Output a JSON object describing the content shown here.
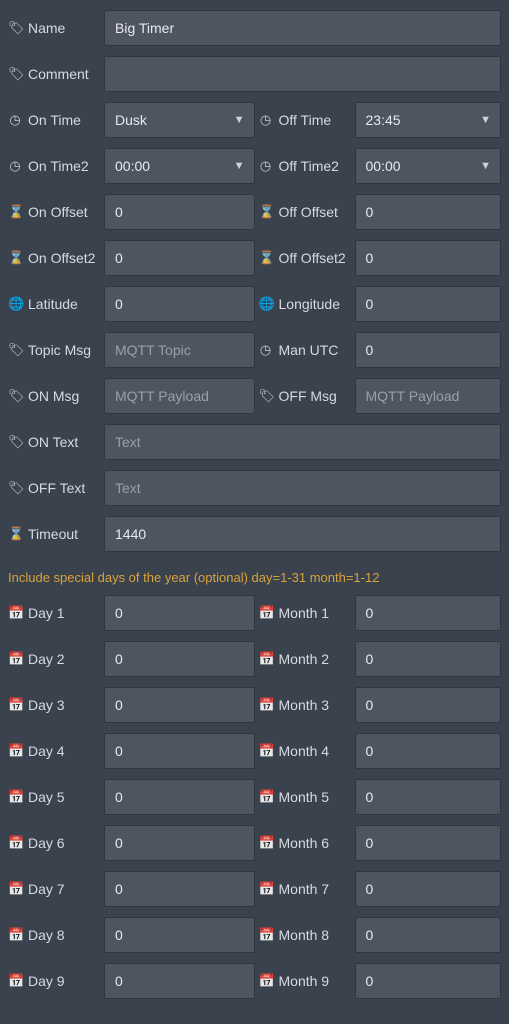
{
  "icons": {
    "tag": "🏷",
    "clock": "◷",
    "hourglass": "⌛",
    "globe": "🌐",
    "calendar": "📅"
  },
  "fields": {
    "name": {
      "label": "Name",
      "value": "Big Timer"
    },
    "comment": {
      "label": "Comment",
      "value": ""
    },
    "on_time": {
      "label": "On Time",
      "value": "Dusk"
    },
    "off_time": {
      "label": "Off Time",
      "value": "23:45"
    },
    "on_time2": {
      "label": "On Time2",
      "value": "00:00"
    },
    "off_time2": {
      "label": "Off Time2",
      "value": "00:00"
    },
    "on_offset": {
      "label": "On Offset",
      "value": "0"
    },
    "off_offset": {
      "label": "Off Offset",
      "value": "0"
    },
    "on_offset2": {
      "label": "On Offset2",
      "value": "0"
    },
    "off_offset2": {
      "label": "Off Offset2",
      "value": "0"
    },
    "latitude": {
      "label": "Latitude",
      "value": "0"
    },
    "longitude": {
      "label": "Longitude",
      "value": "0"
    },
    "topic_msg": {
      "label": "Topic Msg",
      "placeholder": "MQTT Topic",
      "value": ""
    },
    "man_utc": {
      "label": "Man UTC",
      "value": "0"
    },
    "on_msg": {
      "label": "ON Msg",
      "placeholder": "MQTT Payload",
      "value": ""
    },
    "off_msg": {
      "label": "OFF Msg",
      "placeholder": "MQTT Payload",
      "value": ""
    },
    "on_text": {
      "label": "ON Text",
      "placeholder": "Text",
      "value": ""
    },
    "off_text": {
      "label": "OFF Text",
      "placeholder": "Text",
      "value": ""
    },
    "timeout": {
      "label": "Timeout",
      "value": "1440"
    }
  },
  "note": "Include special days of the year (optional) day=1-31 month=1-12",
  "days": [
    {
      "day_label": "Day 1",
      "day_value": "0",
      "month_label": "Month 1",
      "month_value": "0"
    },
    {
      "day_label": "Day 2",
      "day_value": "0",
      "month_label": "Month 2",
      "month_value": "0"
    },
    {
      "day_label": "Day 3",
      "day_value": "0",
      "month_label": "Month 3",
      "month_value": "0"
    },
    {
      "day_label": "Day 4",
      "day_value": "0",
      "month_label": "Month 4",
      "month_value": "0"
    },
    {
      "day_label": "Day 5",
      "day_value": "0",
      "month_label": "Month 5",
      "month_value": "0"
    },
    {
      "day_label": "Day 6",
      "day_value": "0",
      "month_label": "Month 6",
      "month_value": "0"
    },
    {
      "day_label": "Day 7",
      "day_value": "0",
      "month_label": "Month 7",
      "month_value": "0"
    },
    {
      "day_label": "Day 8",
      "day_value": "0",
      "month_label": "Month 8",
      "month_value": "0"
    },
    {
      "day_label": "Day 9",
      "day_value": "0",
      "month_label": "Month 9",
      "month_value": "0"
    }
  ]
}
